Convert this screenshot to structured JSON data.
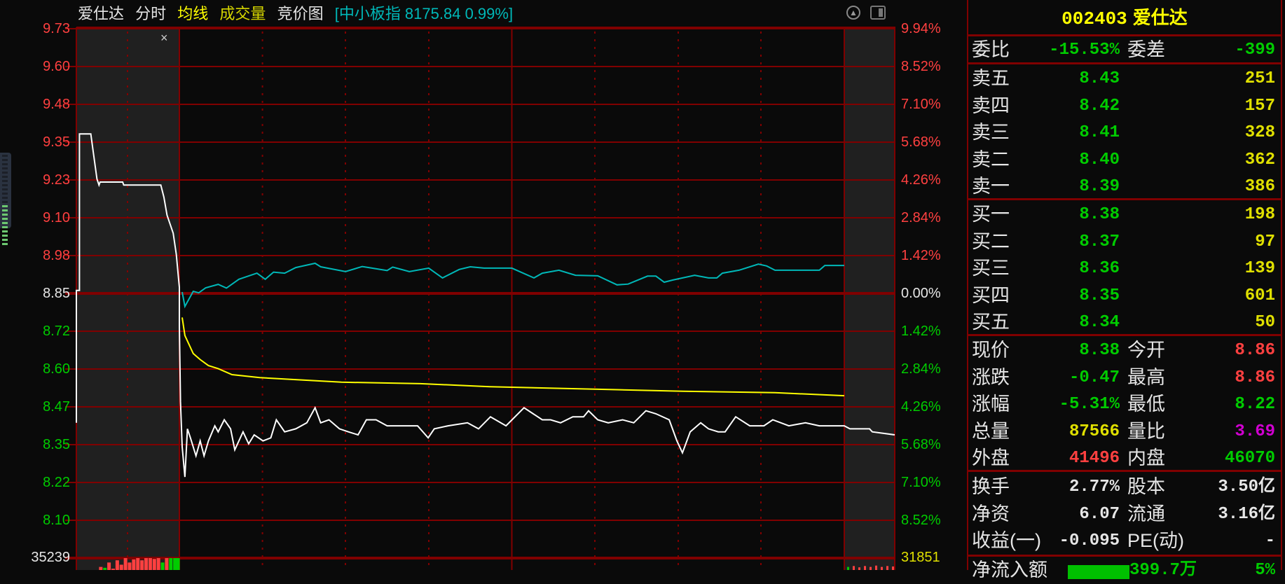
{
  "title": {
    "stock_name": "爱仕达",
    "tabs": [
      {
        "label": "分时",
        "color": "#e6e6e6"
      },
      {
        "label": "均线",
        "color": "#ffff00"
      },
      {
        "label": "成交量",
        "color": "#d6d600"
      },
      {
        "label": "竞价图",
        "color": "#e6e6e6"
      }
    ],
    "index_info": "[中小板指 8175.84 0.99%]"
  },
  "close_symbol": "×",
  "axis": {
    "left": [
      "9.73",
      "9.60",
      "9.48",
      "9.35",
      "9.23",
      "9.10",
      "8.98",
      "8.85",
      "8.72",
      "8.60",
      "8.47",
      "8.35",
      "8.22",
      "8.10"
    ],
    "right": [
      "9.94%",
      "8.52%",
      "7.10%",
      "5.68%",
      "4.26%",
      "2.84%",
      "1.42%",
      "0.00%",
      "1.42%",
      "2.84%",
      "4.26%",
      "5.68%",
      "7.10%",
      "8.52%"
    ],
    "volume_left": "35239",
    "volume_right": "31851"
  },
  "panel": {
    "code": "002403",
    "name": "爱仕达",
    "wei": {
      "l1": "委比",
      "v1": "-15.53%",
      "c1": "green",
      "l2": "委差",
      "v2": "-399",
      "c2": "green"
    },
    "sell": [
      {
        "label": "卖五",
        "price": "8.43",
        "vol": "251"
      },
      {
        "label": "卖四",
        "price": "8.42",
        "vol": "157"
      },
      {
        "label": "卖三",
        "price": "8.41",
        "vol": "328"
      },
      {
        "label": "卖二",
        "price": "8.40",
        "vol": "362"
      },
      {
        "label": "卖一",
        "price": "8.39",
        "vol": "386"
      }
    ],
    "buy": [
      {
        "label": "买一",
        "price": "8.38",
        "vol": "198"
      },
      {
        "label": "买二",
        "price": "8.37",
        "vol": "97"
      },
      {
        "label": "买三",
        "price": "8.36",
        "vol": "139"
      },
      {
        "label": "买四",
        "price": "8.35",
        "vol": "601"
      },
      {
        "label": "买五",
        "price": "8.34",
        "vol": "50"
      }
    ],
    "stats": [
      {
        "l1": "现价",
        "v1": "8.38",
        "c1": "green",
        "l2": "今开",
        "v2": "8.86",
        "c2": "red"
      },
      {
        "l1": "涨跌",
        "v1": "-0.47",
        "c1": "green",
        "l2": "最高",
        "v2": "8.86",
        "c2": "red"
      },
      {
        "l1": "涨幅",
        "v1": "-5.31%",
        "c1": "green",
        "l2": "最低",
        "v2": "8.22",
        "c2": "green"
      },
      {
        "l1": "总量",
        "v1": "87566",
        "c1": "yellow",
        "l2": "量比",
        "v2": "3.69",
        "c2": "magenta"
      },
      {
        "l1": "外盘",
        "v1": "41496",
        "c1": "red",
        "l2": "内盘",
        "v2": "46070",
        "c2": "green"
      }
    ],
    "info": [
      {
        "l1": "换手",
        "v1": "2.77%",
        "c1": "white",
        "l2": "股本",
        "v2": "3.50亿",
        "c2": "white"
      },
      {
        "l1": "净资",
        "v1": "6.07",
        "c1": "white",
        "l2": "流通",
        "v2": "3.16亿",
        "c2": "white"
      },
      {
        "l1": "收益(一)",
        "v1": "-0.095",
        "c1": "white",
        "l2": "PE(动)",
        "v2": "-",
        "c2": "white"
      }
    ],
    "flow": {
      "label": "净流入额",
      "value": "399.7万",
      "pct": "5%"
    }
  },
  "colors": {
    "grid": "#800000",
    "price": "#ffffff",
    "avg": "#ffff00",
    "index": "#00b8b8",
    "up": "#ff4040",
    "down": "#00cc00"
  },
  "chart_data": {
    "type": "line",
    "prev_close": 8.85,
    "price_range": [
      8.1,
      9.73
    ],
    "pct_range": [
      -8.52,
      9.94
    ],
    "segments": {
      "auction_minutes": 10,
      "trading_minutes": 240,
      "post_minutes": 18
    },
    "series": [
      {
        "name": "price",
        "auction": [
          [
            0,
            8.42
          ],
          [
            0,
            8.86
          ],
          [
            0.3,
            8.86
          ],
          [
            0.3,
            9.38
          ],
          [
            1.4,
            9.38
          ],
          [
            1.6,
            9.33
          ],
          [
            2.0,
            9.23
          ],
          [
            2.2,
            9.21
          ],
          [
            2.3,
            9.22
          ],
          [
            4.5,
            9.22
          ],
          [
            4.6,
            9.21
          ],
          [
            8.2,
            9.21
          ],
          [
            8.5,
            9.17
          ],
          [
            8.8,
            9.11
          ],
          [
            9.4,
            9.05
          ],
          [
            9.7,
            8.98
          ],
          [
            10,
            8.87
          ]
        ],
        "trading": [
          [
            0,
            8.74
          ],
          [
            0.4,
            8.49
          ],
          [
            1,
            8.34
          ],
          [
            2,
            8.24
          ],
          [
            2.9,
            8.4
          ],
          [
            4,
            8.37
          ],
          [
            6,
            8.31
          ],
          [
            7.5,
            8.36
          ],
          [
            8.9,
            8.31
          ],
          [
            10.5,
            8.36
          ],
          [
            12.8,
            8.41
          ],
          [
            14,
            8.39
          ],
          [
            16.2,
            8.43
          ],
          [
            18.5,
            8.4
          ],
          [
            20,
            8.33
          ],
          [
            23,
            8.39
          ],
          [
            25,
            8.35
          ],
          [
            27,
            8.38
          ],
          [
            30.2,
            8.36
          ],
          [
            33,
            8.37
          ],
          [
            35,
            8.43
          ],
          [
            38,
            8.39
          ],
          [
            42,
            8.4
          ],
          [
            46,
            8.42
          ],
          [
            49,
            8.47
          ],
          [
            51,
            8.42
          ],
          [
            54,
            8.43
          ],
          [
            57.8,
            8.4
          ],
          [
            61,
            8.39
          ],
          [
            64.5,
            8.38
          ],
          [
            67.5,
            8.43
          ],
          [
            71,
            8.43
          ],
          [
            75,
            8.41
          ],
          [
            79.7,
            8.41
          ],
          [
            86,
            8.41
          ],
          [
            89.8,
            8.37
          ],
          [
            92,
            8.4
          ],
          [
            97,
            8.41
          ],
          [
            104,
            8.42
          ],
          [
            108,
            8.4
          ],
          [
            112.3,
            8.44
          ],
          [
            117.9,
            8.41
          ],
          [
            124.4,
            8.47
          ],
          [
            131,
            8.43
          ],
          [
            134,
            8.43
          ],
          [
            137.6,
            8.42
          ],
          [
            142,
            8.44
          ],
          [
            145.9,
            8.44
          ],
          [
            147.7,
            8.46
          ],
          [
            151,
            8.43
          ],
          [
            154.8,
            8.42
          ],
          [
            160,
            8.43
          ],
          [
            164,
            8.42
          ],
          [
            168.4,
            8.46
          ],
          [
            172,
            8.45
          ],
          [
            176.8,
            8.43
          ],
          [
            179.6,
            8.36
          ],
          [
            181.6,
            8.32
          ],
          [
            184.4,
            8.39
          ],
          [
            188.2,
            8.42
          ],
          [
            191,
            8.4
          ],
          [
            194.5,
            8.39
          ],
          [
            197,
            8.39
          ],
          [
            200.8,
            8.44
          ],
          [
            205.9,
            8.41
          ],
          [
            211,
            8.41
          ],
          [
            214.2,
            8.43
          ],
          [
            220,
            8.41
          ],
          [
            226,
            8.42
          ],
          [
            231,
            8.41
          ],
          [
            236,
            8.41
          ],
          [
            239.5,
            8.41
          ]
        ],
        "post": [
          [
            0,
            8.41
          ],
          [
            2,
            8.4
          ],
          [
            9,
            8.4
          ],
          [
            10,
            8.39
          ],
          [
            18,
            8.38
          ]
        ]
      },
      {
        "name": "average",
        "trading": [
          [
            1,
            8.77
          ],
          [
            2,
            8.71
          ],
          [
            5,
            8.65
          ],
          [
            7.5,
            8.63
          ],
          [
            10.5,
            8.61
          ],
          [
            14,
            8.6
          ],
          [
            19,
            8.58
          ],
          [
            29,
            8.57
          ],
          [
            39,
            8.565
          ],
          [
            58.5,
            8.555
          ],
          [
            87,
            8.55
          ],
          [
            112,
            8.54
          ],
          [
            158,
            8.53
          ],
          [
            182,
            8.525
          ],
          [
            215,
            8.52
          ],
          [
            240,
            8.51
          ]
        ]
      },
      {
        "name": "index_pct",
        "trading": [
          [
            1,
            0.05
          ],
          [
            2,
            -0.49
          ],
          [
            5,
            0.08
          ],
          [
            7,
            0.02
          ],
          [
            9.5,
            0.21
          ],
          [
            14,
            0.34
          ],
          [
            17,
            0.2
          ],
          [
            21.5,
            0.53
          ],
          [
            28,
            0.76
          ],
          [
            31,
            0.53
          ],
          [
            34,
            0.8
          ],
          [
            38,
            0.76
          ],
          [
            42,
            0.97
          ],
          [
            49,
            1.13
          ],
          [
            51,
            1.0
          ],
          [
            60,
            0.82
          ],
          [
            66,
            1.01
          ],
          [
            75,
            0.86
          ],
          [
            77,
            0.99
          ],
          [
            83,
            0.82
          ],
          [
            90,
            0.95
          ],
          [
            95,
            0.58
          ],
          [
            101,
            0.9
          ],
          [
            105,
            1.0
          ],
          [
            110,
            0.95
          ],
          [
            112,
            0.95
          ],
          [
            120,
            0.95
          ],
          [
            128,
            0.58
          ],
          [
            131,
            0.76
          ],
          [
            137,
            0.87
          ],
          [
            143,
            0.68
          ],
          [
            151,
            0.66
          ],
          [
            158,
            0.32
          ],
          [
            162,
            0.35
          ],
          [
            169,
            0.65
          ],
          [
            172,
            0.65
          ],
          [
            175,
            0.42
          ],
          [
            178,
            0.5
          ],
          [
            186,
            0.68
          ],
          [
            191,
            0.58
          ],
          [
            194,
            0.58
          ],
          [
            196,
            0.76
          ],
          [
            202,
            0.87
          ],
          [
            209,
            1.1
          ],
          [
            212,
            1.03
          ],
          [
            215,
            0.87
          ],
          [
            231,
            0.87
          ],
          [
            233,
            1.05
          ],
          [
            240,
            1.05
          ]
        ]
      }
    ],
    "volume": {
      "axis_max": 35239,
      "auction": [
        [
          2.2,
          0.8,
          "up"
        ],
        [
          2.6,
          0.78,
          "down"
        ],
        [
          3,
          0.9,
          "up"
        ],
        [
          3.4,
          0.76,
          "up"
        ],
        [
          3.8,
          0.95,
          "up"
        ],
        [
          4.2,
          0.85,
          "up"
        ],
        [
          4.6,
          1,
          "up"
        ],
        [
          5,
          0.9,
          "up"
        ],
        [
          5.4,
          0.97,
          "up"
        ],
        [
          5.8,
          1,
          "up"
        ],
        [
          6.2,
          0.95,
          "up"
        ],
        [
          6.6,
          1,
          "up"
        ],
        [
          7,
          1,
          "up"
        ],
        [
          7.4,
          0.98,
          "up"
        ],
        [
          7.8,
          1,
          "up"
        ],
        [
          8.2,
          0.9,
          "down"
        ],
        [
          8.6,
          1,
          "up"
        ],
        [
          9,
          1,
          "down"
        ],
        [
          9.4,
          1,
          "down"
        ],
        [
          9.7,
          1,
          "down"
        ]
      ],
      "post": [
        [
          1,
          0.8,
          "down"
        ],
        [
          3,
          0.82,
          "up"
        ],
        [
          5,
          0.79,
          "up"
        ],
        [
          7,
          0.82,
          "up"
        ],
        [
          9,
          0.8,
          "up"
        ],
        [
          11,
          0.83,
          "up"
        ],
        [
          13,
          0.8,
          "up"
        ],
        [
          15,
          0.82,
          "up"
        ],
        [
          17,
          0.81,
          "up"
        ]
      ]
    }
  }
}
